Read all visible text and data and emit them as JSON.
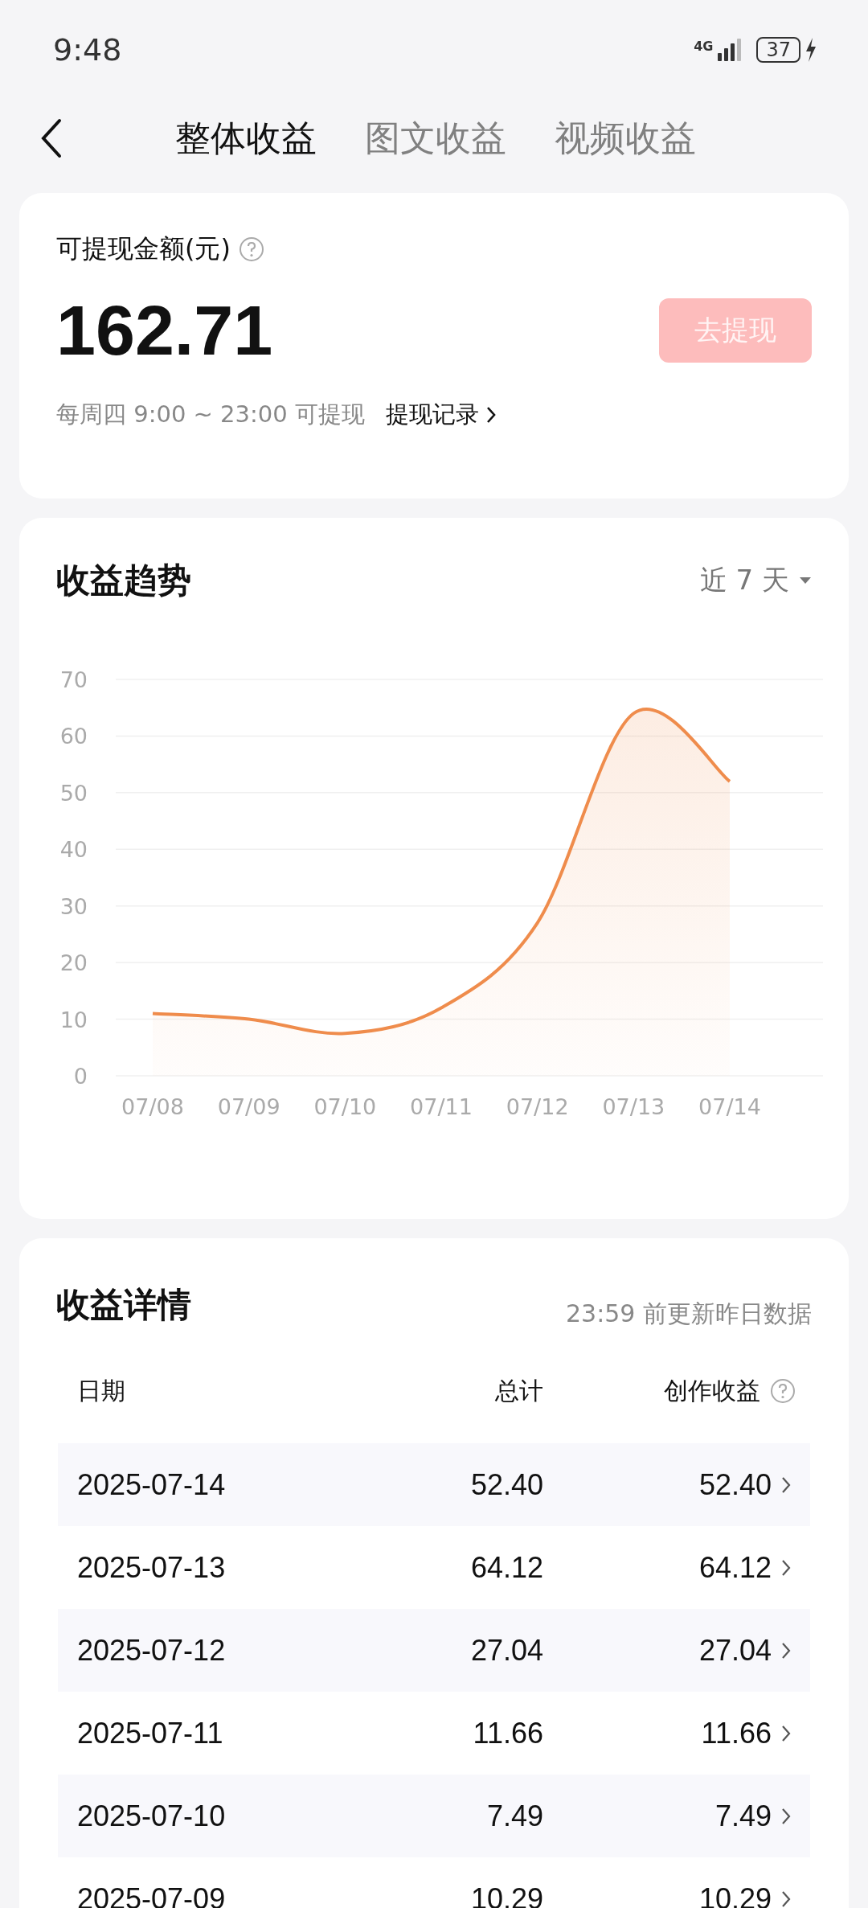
{
  "status_bar": {
    "time": "9:48",
    "network": "4G",
    "battery": "37"
  },
  "tabs": [
    {
      "label": "整体收益",
      "selected": true
    },
    {
      "label": "图文收益",
      "selected": false
    },
    {
      "label": "视频收益",
      "selected": false
    }
  ],
  "balance": {
    "label": "可提现金额(元)",
    "amount": "162.71",
    "button": "去提现",
    "button_disabled": true,
    "note": "每周四 9:00 ~ 23:00 可提现",
    "link": "提现记录"
  },
  "trend": {
    "title": "收益趋势",
    "range": "近 7 天",
    "chart_data": {
      "type": "area",
      "grid": true,
      "categories": [
        "07/08",
        "07/09",
        "07/10",
        "07/11",
        "07/12",
        "07/13",
        "07/14"
      ],
      "series": [
        {
          "color": "#ef8c4c",
          "values": [
            11,
            10,
            7.5,
            12,
            27,
            64,
            52
          ]
        }
      ],
      "ylim": [
        0,
        70
      ],
      "yticks": [
        0,
        10,
        20,
        30,
        40,
        50,
        60,
        70
      ]
    }
  },
  "details": {
    "title": "收益详情",
    "note": "23:59 前更新昨日数据",
    "columns": [
      "日期",
      "总计",
      "创作收益"
    ],
    "rows": [
      {
        "date": "2025-07-14",
        "total": "52.40",
        "creation": "52.40"
      },
      {
        "date": "2025-07-13",
        "total": "64.12",
        "creation": "64.12"
      },
      {
        "date": "2025-07-12",
        "total": "27.04",
        "creation": "27.04"
      },
      {
        "date": "2025-07-11",
        "total": "11.66",
        "creation": "11.66"
      },
      {
        "date": "2025-07-10",
        "total": "7.49",
        "creation": "7.49"
      },
      {
        "date": "2025-07-09",
        "total": "10.29",
        "creation": "10.29"
      }
    ]
  }
}
